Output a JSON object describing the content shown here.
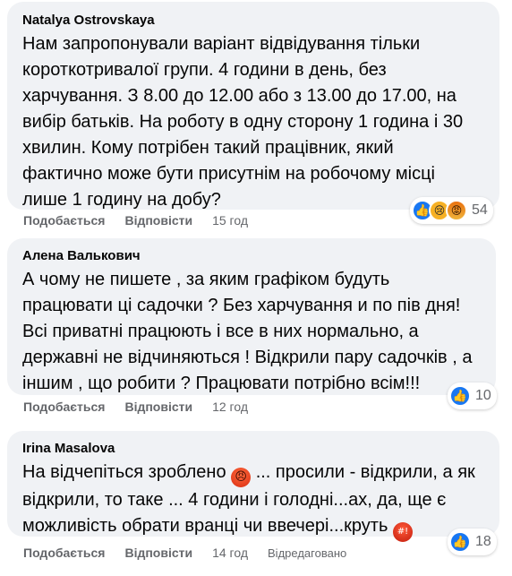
{
  "comments": [
    {
      "author": "Natalya Ostrovskaya",
      "text": "Нам запропонували варіант відвідування тільки\nкороткотривалої групи. 4 години в день, без\nхарчування. З 8.00 до 12.00 або з 13.00 до 17.00, на\nвибір батьків. На роботу в одну сторону 1 година і 30\nхвилин. Кому потрібен такий працівник, який\nфактично може бути присутнім на робочому місці\nлише 1 годину на добу?",
      "reactions": [
        "like",
        "sad",
        "angry"
      ],
      "reaction_count": "54",
      "like_label": "Подобається",
      "reply_label": "Відповісти",
      "time": "15 год"
    },
    {
      "author": "Алена Валькович",
      "text": "А чому не пишете , за яким графіком будуть\nпрацювати ці садочки ? Без харчування и по пів дня!\nВсі приватні працюють і все в них нормально, а\nдержавні не відчиняються ! Відкрили пару садочків , а\nіншим , що робити ? Працювати потрібно всім!!!",
      "reactions": [
        "like"
      ],
      "reaction_count": "10",
      "like_label": "Подобається",
      "reply_label": "Відповісти",
      "time": "12 год"
    },
    {
      "author": "Irina Masalova",
      "text_part1": "На відчепіться зроблено ",
      "text_part2": " ... просили - відкрили, а як\nвідкрили, то таке ... 4 години і голодні...ах, да, ще є\nможливість обрати вранці чи ввечері...круть ",
      "inline_emojis": [
        "angry-face-emoji",
        "face-with-symbols-emoji"
      ],
      "reactions": [
        "like"
      ],
      "reaction_count": "18",
      "like_label": "Подобається",
      "reply_label": "Відповісти",
      "time": "14 год",
      "edited_label": "Відредаговано"
    }
  ],
  "colors": {
    "bubble": "#f0f2f5",
    "meta_text": "#65676b",
    "like_blue": "#1877f2"
  }
}
